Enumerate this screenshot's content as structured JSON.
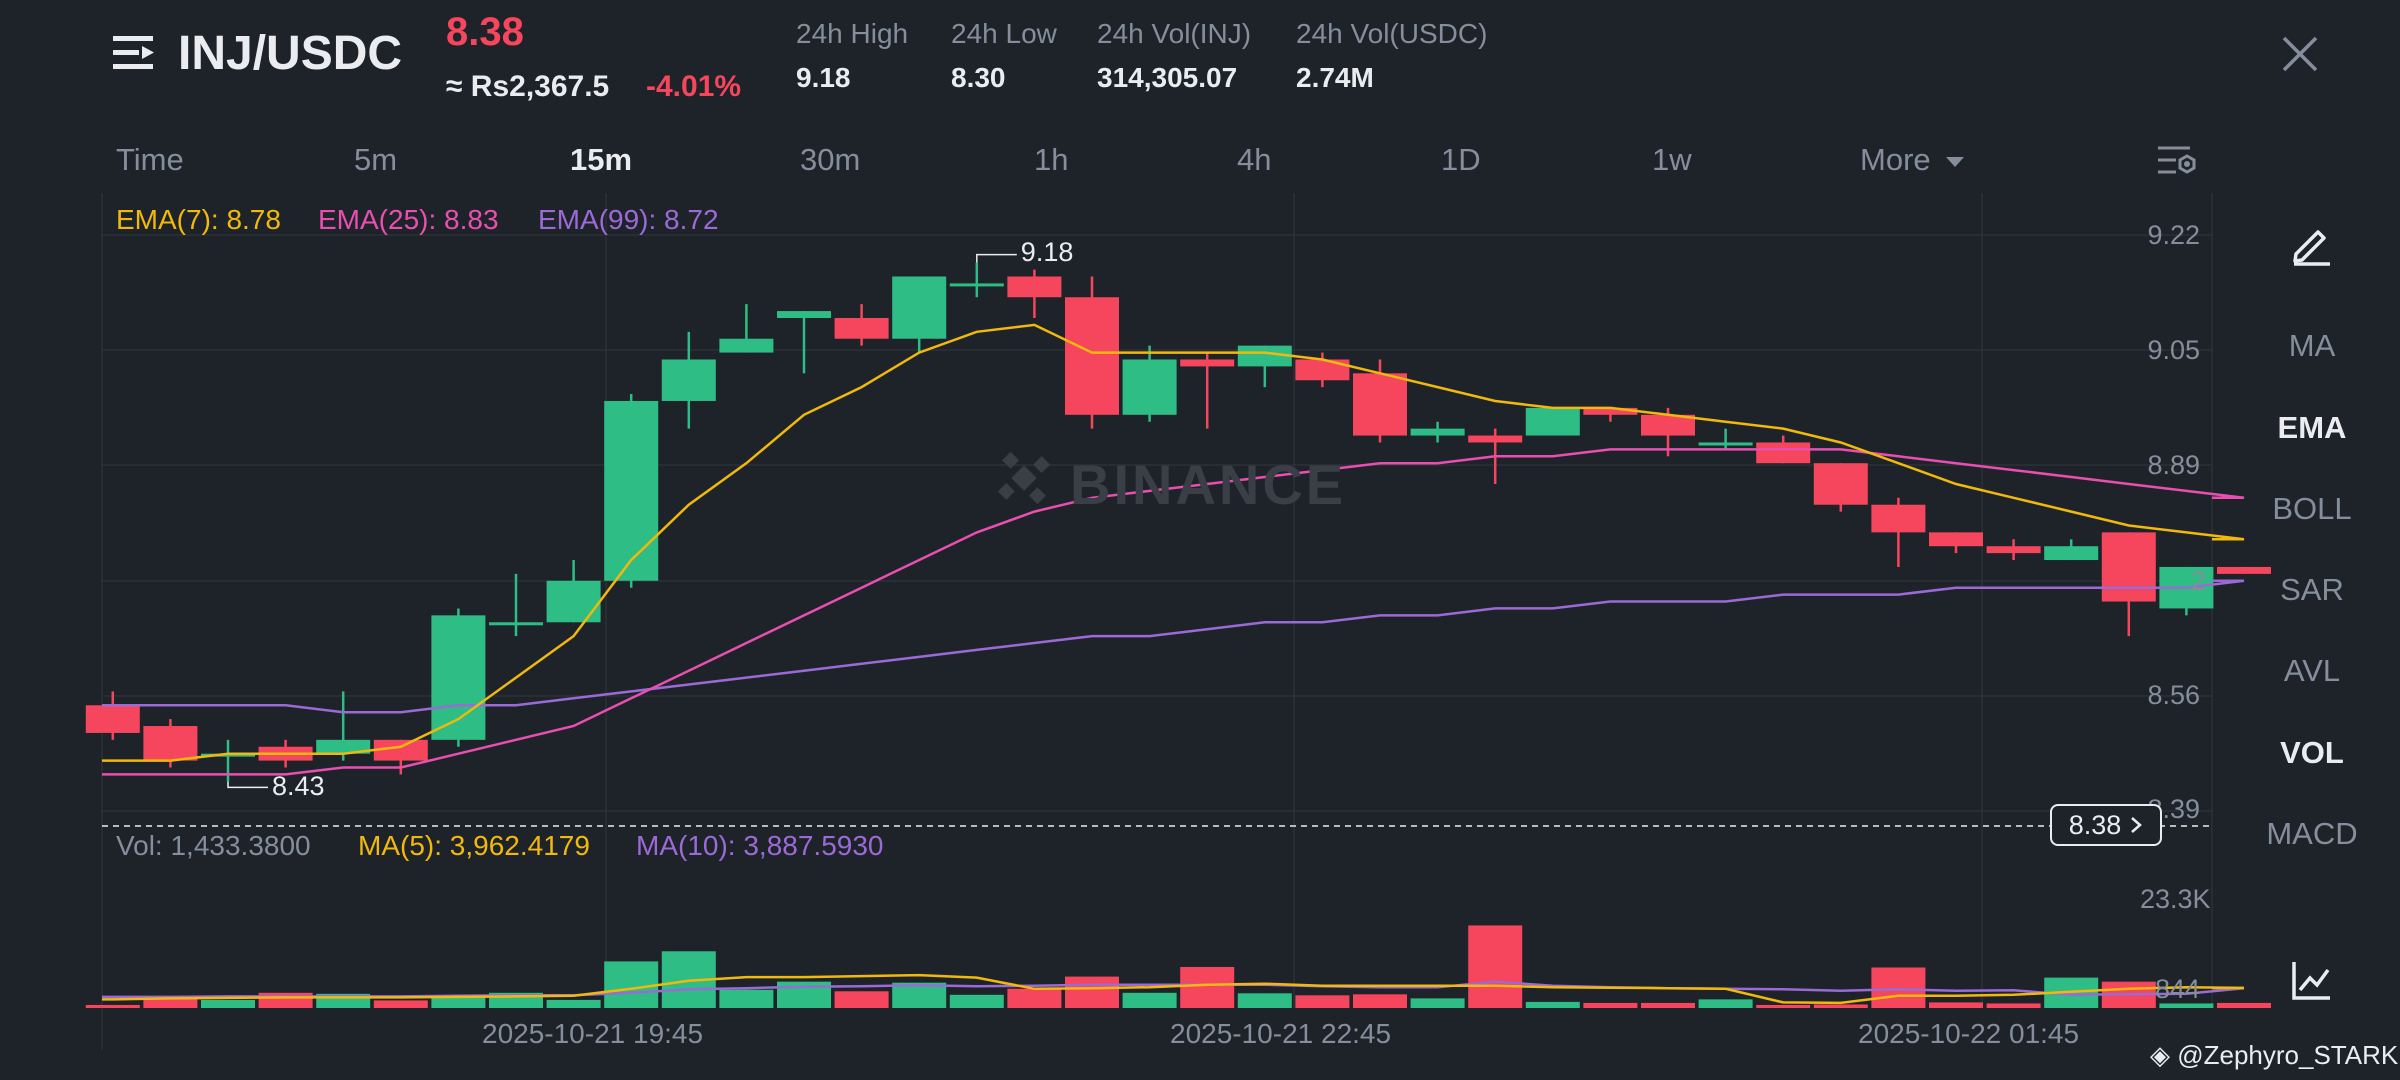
{
  "header": {
    "pair": "INJ/USDC",
    "price": "8.38",
    "fiat_price": "≈ Rs2,367.5",
    "change": "-4.01%",
    "stats": [
      {
        "label": "24h High",
        "value": "9.18"
      },
      {
        "label": "24h Low",
        "value": "8.30"
      },
      {
        "label": "24h Vol(INJ)",
        "value": "314,305.07"
      },
      {
        "label": "24h Vol(USDC)",
        "value": "2.74M"
      }
    ]
  },
  "timeframes": [
    "Time",
    "5m",
    "15m",
    "30m",
    "1h",
    "4h",
    "1D",
    "1w",
    "More"
  ],
  "active_timeframe": "15m",
  "indicators": {
    "ema7": "EMA(7): 8.78",
    "ema25": "EMA(25): 8.83",
    "ema99": "EMA(99): 8.72"
  },
  "volume_indicators": {
    "vol": "Vol: 1,433.3800",
    "ma5": "MA(5): 3,962.4179",
    "ma10": "MA(10): 3,887.5930"
  },
  "price_axis": [
    "9.22",
    "9.05",
    "8.89",
    "8.56",
    "8.39"
  ],
  "volume_axis": [
    "23.3K",
    "844"
  ],
  "price_tag": "8.38",
  "high_marker": "9.18",
  "low_marker": "8.43",
  "partial_price_label": "2",
  "dates": [
    "2025-10-21 19:45",
    "2025-10-21 22:45",
    "2025-10-22 01:45"
  ],
  "side_menu": [
    "MA",
    "EMA",
    "BOLL",
    "SAR",
    "AVL",
    "VOL",
    "MACD"
  ],
  "side_menu_active": [
    "EMA",
    "VOL"
  ],
  "watermark": "BINANCE",
  "credit": "@Zephyro_STARK",
  "colors": {
    "up": "#2ebd85",
    "down": "#f6465d",
    "ema7": "#f0b90b",
    "ema25": "#e84fb0",
    "ema99": "#9b6ad6",
    "bg": "#1e2329",
    "muted": "#848e9c"
  },
  "chart_data": {
    "type": "candlestick",
    "candles": [
      {
        "o": 8.54,
        "c": 8.5,
        "h": 8.56,
        "l": 8.49
      },
      {
        "o": 8.51,
        "c": 8.46,
        "h": 8.52,
        "l": 8.45
      },
      {
        "o": 8.47,
        "c": 8.47,
        "h": 8.49,
        "l": 8.43
      },
      {
        "o": 8.48,
        "c": 8.46,
        "h": 8.49,
        "l": 8.45
      },
      {
        "o": 8.47,
        "c": 8.49,
        "h": 8.56,
        "l": 8.46
      },
      {
        "o": 8.49,
        "c": 8.46,
        "h": 8.49,
        "l": 8.44
      },
      {
        "o": 8.49,
        "c": 8.67,
        "h": 8.68,
        "l": 8.48
      },
      {
        "o": 8.66,
        "c": 8.66,
        "h": 8.73,
        "l": 8.64
      },
      {
        "o": 8.66,
        "c": 8.72,
        "h": 8.75,
        "l": 8.66
      },
      {
        "o": 8.72,
        "c": 8.98,
        "h": 8.99,
        "l": 8.71
      },
      {
        "o": 8.98,
        "c": 9.04,
        "h": 9.08,
        "l": 8.94
      },
      {
        "o": 9.05,
        "c": 9.07,
        "h": 9.12,
        "l": 9.05
      },
      {
        "o": 9.1,
        "c": 9.11,
        "h": 9.11,
        "l": 9.02
      },
      {
        "o": 9.1,
        "c": 9.07,
        "h": 9.12,
        "l": 9.06
      },
      {
        "o": 9.07,
        "c": 9.16,
        "h": 9.16,
        "l": 9.05
      },
      {
        "o": 9.15,
        "c": 9.15,
        "h": 9.18,
        "l": 9.13
      },
      {
        "o": 9.16,
        "c": 9.13,
        "h": 9.17,
        "l": 9.1
      },
      {
        "o": 9.13,
        "c": 8.96,
        "h": 9.16,
        "l": 8.94
      },
      {
        "o": 8.96,
        "c": 9.04,
        "h": 9.06,
        "l": 8.95
      },
      {
        "o": 9.04,
        "c": 9.03,
        "h": 9.05,
        "l": 8.94
      },
      {
        "o": 9.03,
        "c": 9.06,
        "h": 9.06,
        "l": 9.0
      },
      {
        "o": 9.04,
        "c": 9.01,
        "h": 9.05,
        "l": 9.0
      },
      {
        "o": 9.02,
        "c": 8.93,
        "h": 9.04,
        "l": 8.92
      },
      {
        "o": 8.93,
        "c": 8.94,
        "h": 8.95,
        "l": 8.92
      },
      {
        "o": 8.93,
        "c": 8.92,
        "h": 8.94,
        "l": 8.86
      },
      {
        "o": 8.93,
        "c": 8.97,
        "h": 8.97,
        "l": 8.93
      },
      {
        "o": 8.97,
        "c": 8.96,
        "h": 8.97,
        "l": 8.95
      },
      {
        "o": 8.96,
        "c": 8.93,
        "h": 8.97,
        "l": 8.9
      },
      {
        "o": 8.92,
        "c": 8.92,
        "h": 8.94,
        "l": 8.91
      },
      {
        "o": 8.92,
        "c": 8.89,
        "h": 8.93,
        "l": 8.89
      },
      {
        "o": 8.89,
        "c": 8.83,
        "h": 8.89,
        "l": 8.82
      },
      {
        "o": 8.83,
        "c": 8.79,
        "h": 8.84,
        "l": 8.74
      },
      {
        "o": 8.79,
        "c": 8.77,
        "h": 8.79,
        "l": 8.76
      },
      {
        "o": 8.77,
        "c": 8.76,
        "h": 8.78,
        "l": 8.75
      },
      {
        "o": 8.75,
        "c": 8.77,
        "h": 8.78,
        "l": 8.75
      },
      {
        "o": 8.79,
        "c": 8.69,
        "h": 8.79,
        "l": 8.64
      },
      {
        "o": 8.68,
        "c": 8.74,
        "h": 8.74,
        "l": 8.67
      },
      {
        "o": 8.74,
        "c": 8.73,
        "h": 8.74,
        "l": 8.73
      }
    ],
    "ema7": [
      8.46,
      8.46,
      8.47,
      8.47,
      8.47,
      8.48,
      8.52,
      8.58,
      8.64,
      8.75,
      8.83,
      8.89,
      8.96,
      9.0,
      9.05,
      9.08,
      9.09,
      9.05,
      9.05,
      9.05,
      9.05,
      9.04,
      9.02,
      9.0,
      8.98,
      8.97,
      8.97,
      8.96,
      8.95,
      8.94,
      8.92,
      8.89,
      8.86,
      8.84,
      8.82,
      8.8,
      8.79,
      8.78
    ],
    "ema25": [
      8.44,
      8.44,
      8.44,
      8.44,
      8.45,
      8.45,
      8.47,
      8.49,
      8.51,
      8.55,
      8.59,
      8.63,
      8.67,
      8.71,
      8.75,
      8.79,
      8.82,
      8.84,
      8.85,
      8.86,
      8.87,
      8.88,
      8.89,
      8.89,
      8.9,
      8.9,
      8.91,
      8.91,
      8.91,
      8.91,
      8.91,
      8.9,
      8.89,
      8.88,
      8.87,
      8.86,
      8.85,
      8.84
    ],
    "ema99": [
      8.54,
      8.54,
      8.54,
      8.54,
      8.53,
      8.53,
      8.54,
      8.54,
      8.55,
      8.56,
      8.57,
      8.58,
      8.59,
      8.6,
      8.61,
      8.62,
      8.63,
      8.64,
      8.64,
      8.65,
      8.66,
      8.66,
      8.67,
      8.67,
      8.68,
      8.68,
      8.69,
      8.69,
      8.69,
      8.7,
      8.7,
      8.7,
      8.71,
      8.71,
      8.71,
      8.71,
      8.71,
      8.72
    ],
    "volume": [
      600,
      2000,
      1600,
      3000,
      2800,
      1500,
      2500,
      3000,
      1600,
      9200,
      11200,
      3600,
      5200,
      3300,
      5000,
      2600,
      3800,
      6200,
      3000,
      8100,
      2900,
      2500,
      2700,
      1900,
      16300,
      1200,
      1000,
      1000,
      1700,
      600,
      700,
      8000,
      1100,
      900,
      6000,
      5200,
      900,
      1000
    ],
    "vol_ma5": [
      1700,
      1900,
      2000,
      2100,
      2100,
      2100,
      2200,
      2300,
      2400,
      3800,
      5400,
      6100,
      6100,
      6300,
      6500,
      6000,
      3800,
      3900,
      4100,
      4600,
      4800,
      4400,
      4400,
      4400,
      4400,
      4100,
      4000,
      3900,
      3800,
      1100,
      1000,
      2400,
      2400,
      2600,
      3200,
      3800,
      4100,
      3960
    ],
    "vol_ma10": [
      2200,
      2200,
      2300,
      2300,
      2300,
      2300,
      2400,
      2500,
      2500,
      3000,
      3700,
      3900,
      4200,
      4300,
      4500,
      4300,
      4400,
      4600,
      4600,
      4600,
      4600,
      4300,
      4100,
      4100,
      5200,
      4400,
      4100,
      3900,
      3800,
      3700,
      3400,
      3700,
      3400,
      3500,
      2600,
      2700,
      2800,
      3890
    ],
    "price_range": [
      8.39,
      9.22
    ],
    "volume_range": [
      0,
      23300
    ]
  }
}
